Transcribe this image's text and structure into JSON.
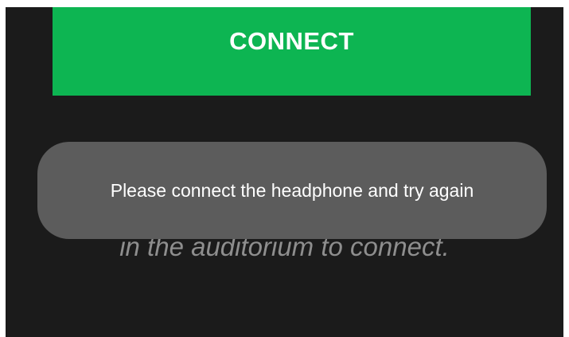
{
  "connect_button": {
    "label": "CONNECT",
    "color": "#0db552"
  },
  "hint": {
    "text": "in the auditorium to connect."
  },
  "toast": {
    "message": "Please connect the headphone and try again",
    "background": "#5c5c5c"
  },
  "colors": {
    "screen_background": "#1b1b1b"
  }
}
